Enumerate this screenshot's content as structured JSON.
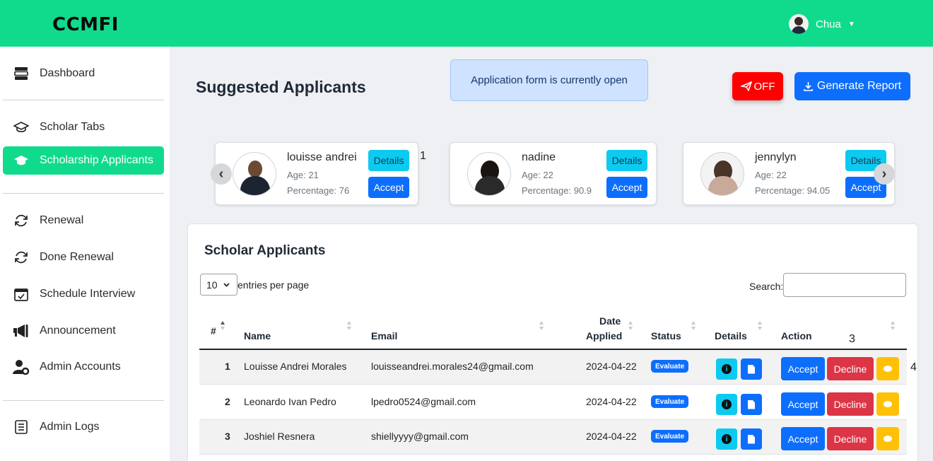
{
  "app": {
    "brand": "CCMFI",
    "user_name": "Chua"
  },
  "sidebar": {
    "items": [
      {
        "label": "Dashboard",
        "icon": "server-icon"
      },
      {
        "label": "Scholar Tabs",
        "icon": "graduation-cap-icon"
      },
      {
        "label": "Scholarship Applicants",
        "icon": "graduation-cap-icon",
        "active": true
      },
      {
        "label": "Renewal",
        "icon": "refresh-icon"
      },
      {
        "label": "Done Renewal",
        "icon": "refresh-icon"
      },
      {
        "label": "Schedule Interview",
        "icon": "calendar-check-icon"
      },
      {
        "label": "Announcement",
        "icon": "megaphone-icon"
      },
      {
        "label": "Admin Accounts",
        "icon": "user-gear-icon"
      },
      {
        "label": "Admin Logs",
        "icon": "log-list-icon"
      }
    ]
  },
  "header": {
    "title": "Suggested Applicants",
    "notice": "Application form is currently open",
    "off_label": "OFF",
    "report_label": "Generate Report"
  },
  "suggested": [
    {
      "name": "louisse andrei",
      "age": "Age: 21",
      "percentage": "Percentage: 76",
      "details": "Details",
      "accept": "Accept"
    },
    {
      "name": "nadine",
      "age": "Age: 22",
      "percentage": "Percentage: 90.9",
      "details": "Details",
      "accept": "Accept"
    },
    {
      "name": "jennylyn",
      "age": "Age: 22",
      "percentage": "Percentage: 94.05",
      "details": "Details",
      "accept": "Accept"
    }
  ],
  "markers": {
    "m1": "1",
    "m3": "3",
    "m4": "4"
  },
  "table": {
    "title": "Scholar Applicants",
    "entries_value": "10",
    "entries_label": "entries per page",
    "search_label": "Search:",
    "columns": {
      "num": "#",
      "name": "Name",
      "email": "Email",
      "date_1": "Date",
      "date_2": "Applied",
      "status": "Status",
      "details": "Details",
      "action": "Action"
    },
    "rows": [
      {
        "num": "1",
        "name": "Louisse Andrei Morales",
        "email": "louisseandrei.morales24@gmail.com",
        "date": "2024-04-22",
        "status": "Evaluate"
      },
      {
        "num": "2",
        "name": "Leonardo Ivan Pedro",
        "email": "lpedro0524@gmail.com",
        "date": "2024-04-22",
        "status": "Evaluate"
      },
      {
        "num": "3",
        "name": "Joshiel Resnera",
        "email": "shiellyyyy@gmail.com",
        "date": "2024-04-22",
        "status": "Evaluate"
      }
    ],
    "accept_label": "Accept",
    "decline_label": "Decline"
  },
  "colors": {
    "brand_green": "#10db8c",
    "primary": "#0d6efd",
    "info": "#0dcaf0",
    "danger": "#dc3545",
    "warning": "#ffc107",
    "off_red": "#ff0000"
  }
}
